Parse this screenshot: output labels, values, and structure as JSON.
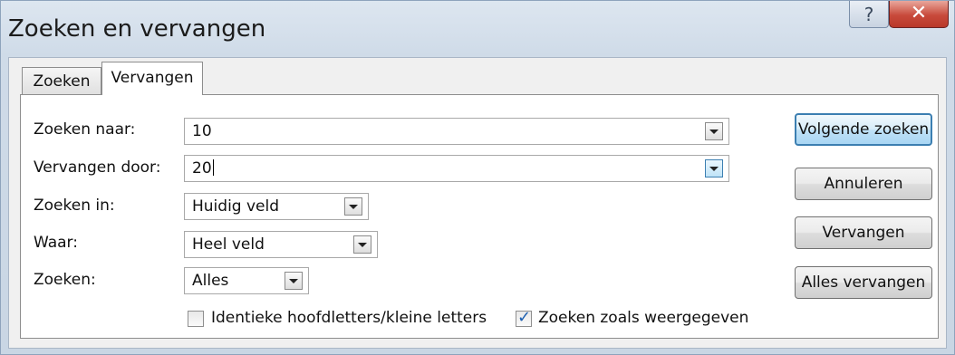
{
  "window": {
    "title": "Zoeken en vervangen",
    "help_glyph": "?",
    "close_glyph": "✕"
  },
  "tabs": [
    {
      "label": "Zoeken",
      "active": false
    },
    {
      "label": "Vervangen",
      "active": true
    }
  ],
  "form": {
    "find_label": "Zoeken naar:",
    "find_value": "10",
    "replace_label": "Vervangen door:",
    "replace_value": "20",
    "lookin_label": "Zoeken in:",
    "lookin_value": "Huidig veld",
    "match_label": "Waar:",
    "match_value": "Heel veld",
    "search_label": "Zoeken:",
    "search_value": "Alles"
  },
  "options": {
    "match_case_label": "Identieke hoofdletters/kleine letters",
    "match_case_checked": false,
    "search_formatted_label": "Zoeken zoals weergegeven",
    "search_formatted_checked": true
  },
  "buttons": {
    "find_next": "Volgende zoeken",
    "cancel": "Annuleren",
    "replace": "Vervangen",
    "replace_all": "Alles vervangen"
  },
  "icons": {
    "check": "✓",
    "dropdown": "chevron-down-icon"
  },
  "colors": {
    "accent": "#3c7fb1",
    "close": "#c84a3b"
  }
}
